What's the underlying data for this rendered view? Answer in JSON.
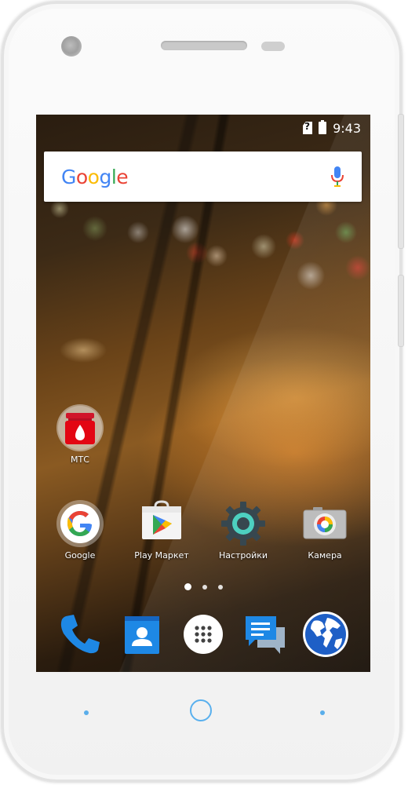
{
  "status_bar": {
    "time": "9:43",
    "icons": [
      "sim-unknown-icon",
      "battery-icon"
    ]
  },
  "search_bar": {
    "logo": [
      "G",
      "o",
      "o",
      "g",
      "l",
      "e"
    ],
    "mic": "mic-icon"
  },
  "home_apps": [
    {
      "label": "МТС",
      "icon": "mts-icon"
    },
    {
      "label": "Google",
      "icon": "google-app-icon"
    },
    {
      "label": "Play Маркет",
      "icon": "play-store-icon"
    },
    {
      "label": "Настройки",
      "icon": "settings-icon"
    },
    {
      "label": "Камера",
      "icon": "camera-icon"
    }
  ],
  "page_indicator": {
    "pages": 3,
    "current": 1
  },
  "dock": [
    {
      "icon": "phone-icon"
    },
    {
      "icon": "contacts-icon"
    },
    {
      "icon": "all-apps-icon"
    },
    {
      "icon": "messages-icon"
    },
    {
      "icon": "browser-globe-icon"
    }
  ],
  "colors": {
    "google_blue": "#4285F4",
    "google_red": "#EA4335",
    "google_yellow": "#FBBC05",
    "google_green": "#34A853",
    "nav_key_blue": "#59B0EE"
  }
}
